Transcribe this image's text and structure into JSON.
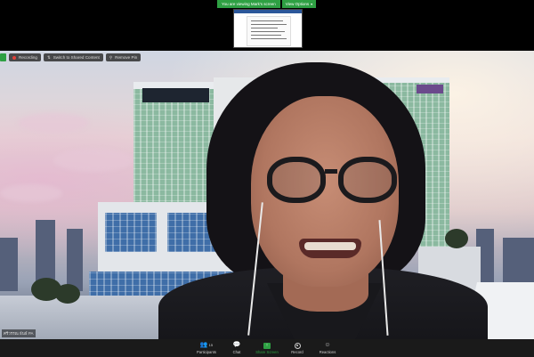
{
  "banner": {
    "sharing_text": "You are viewing Mark's screen",
    "view_options_label": "View Options",
    "view_options_icon": "chevron-down-icon"
  },
  "overlay": {
    "recording_label": "Recording",
    "switch_label": "Switch to Shared Content",
    "remove_pin_label": "Remove Pin"
  },
  "participant": {
    "name_label": "ศรีวรรณ ธันธ์ PA"
  },
  "toolbar": {
    "participants_label": "Participants",
    "participants_count": "15",
    "chat_label": "Chat",
    "share_label": "Share Screen",
    "record_label": "Record",
    "reactions_label": "Reactions"
  },
  "colors": {
    "accent_green": "#2ea043",
    "toolbar_bg": "#1a1a1a",
    "record_red": "#e0403a"
  }
}
